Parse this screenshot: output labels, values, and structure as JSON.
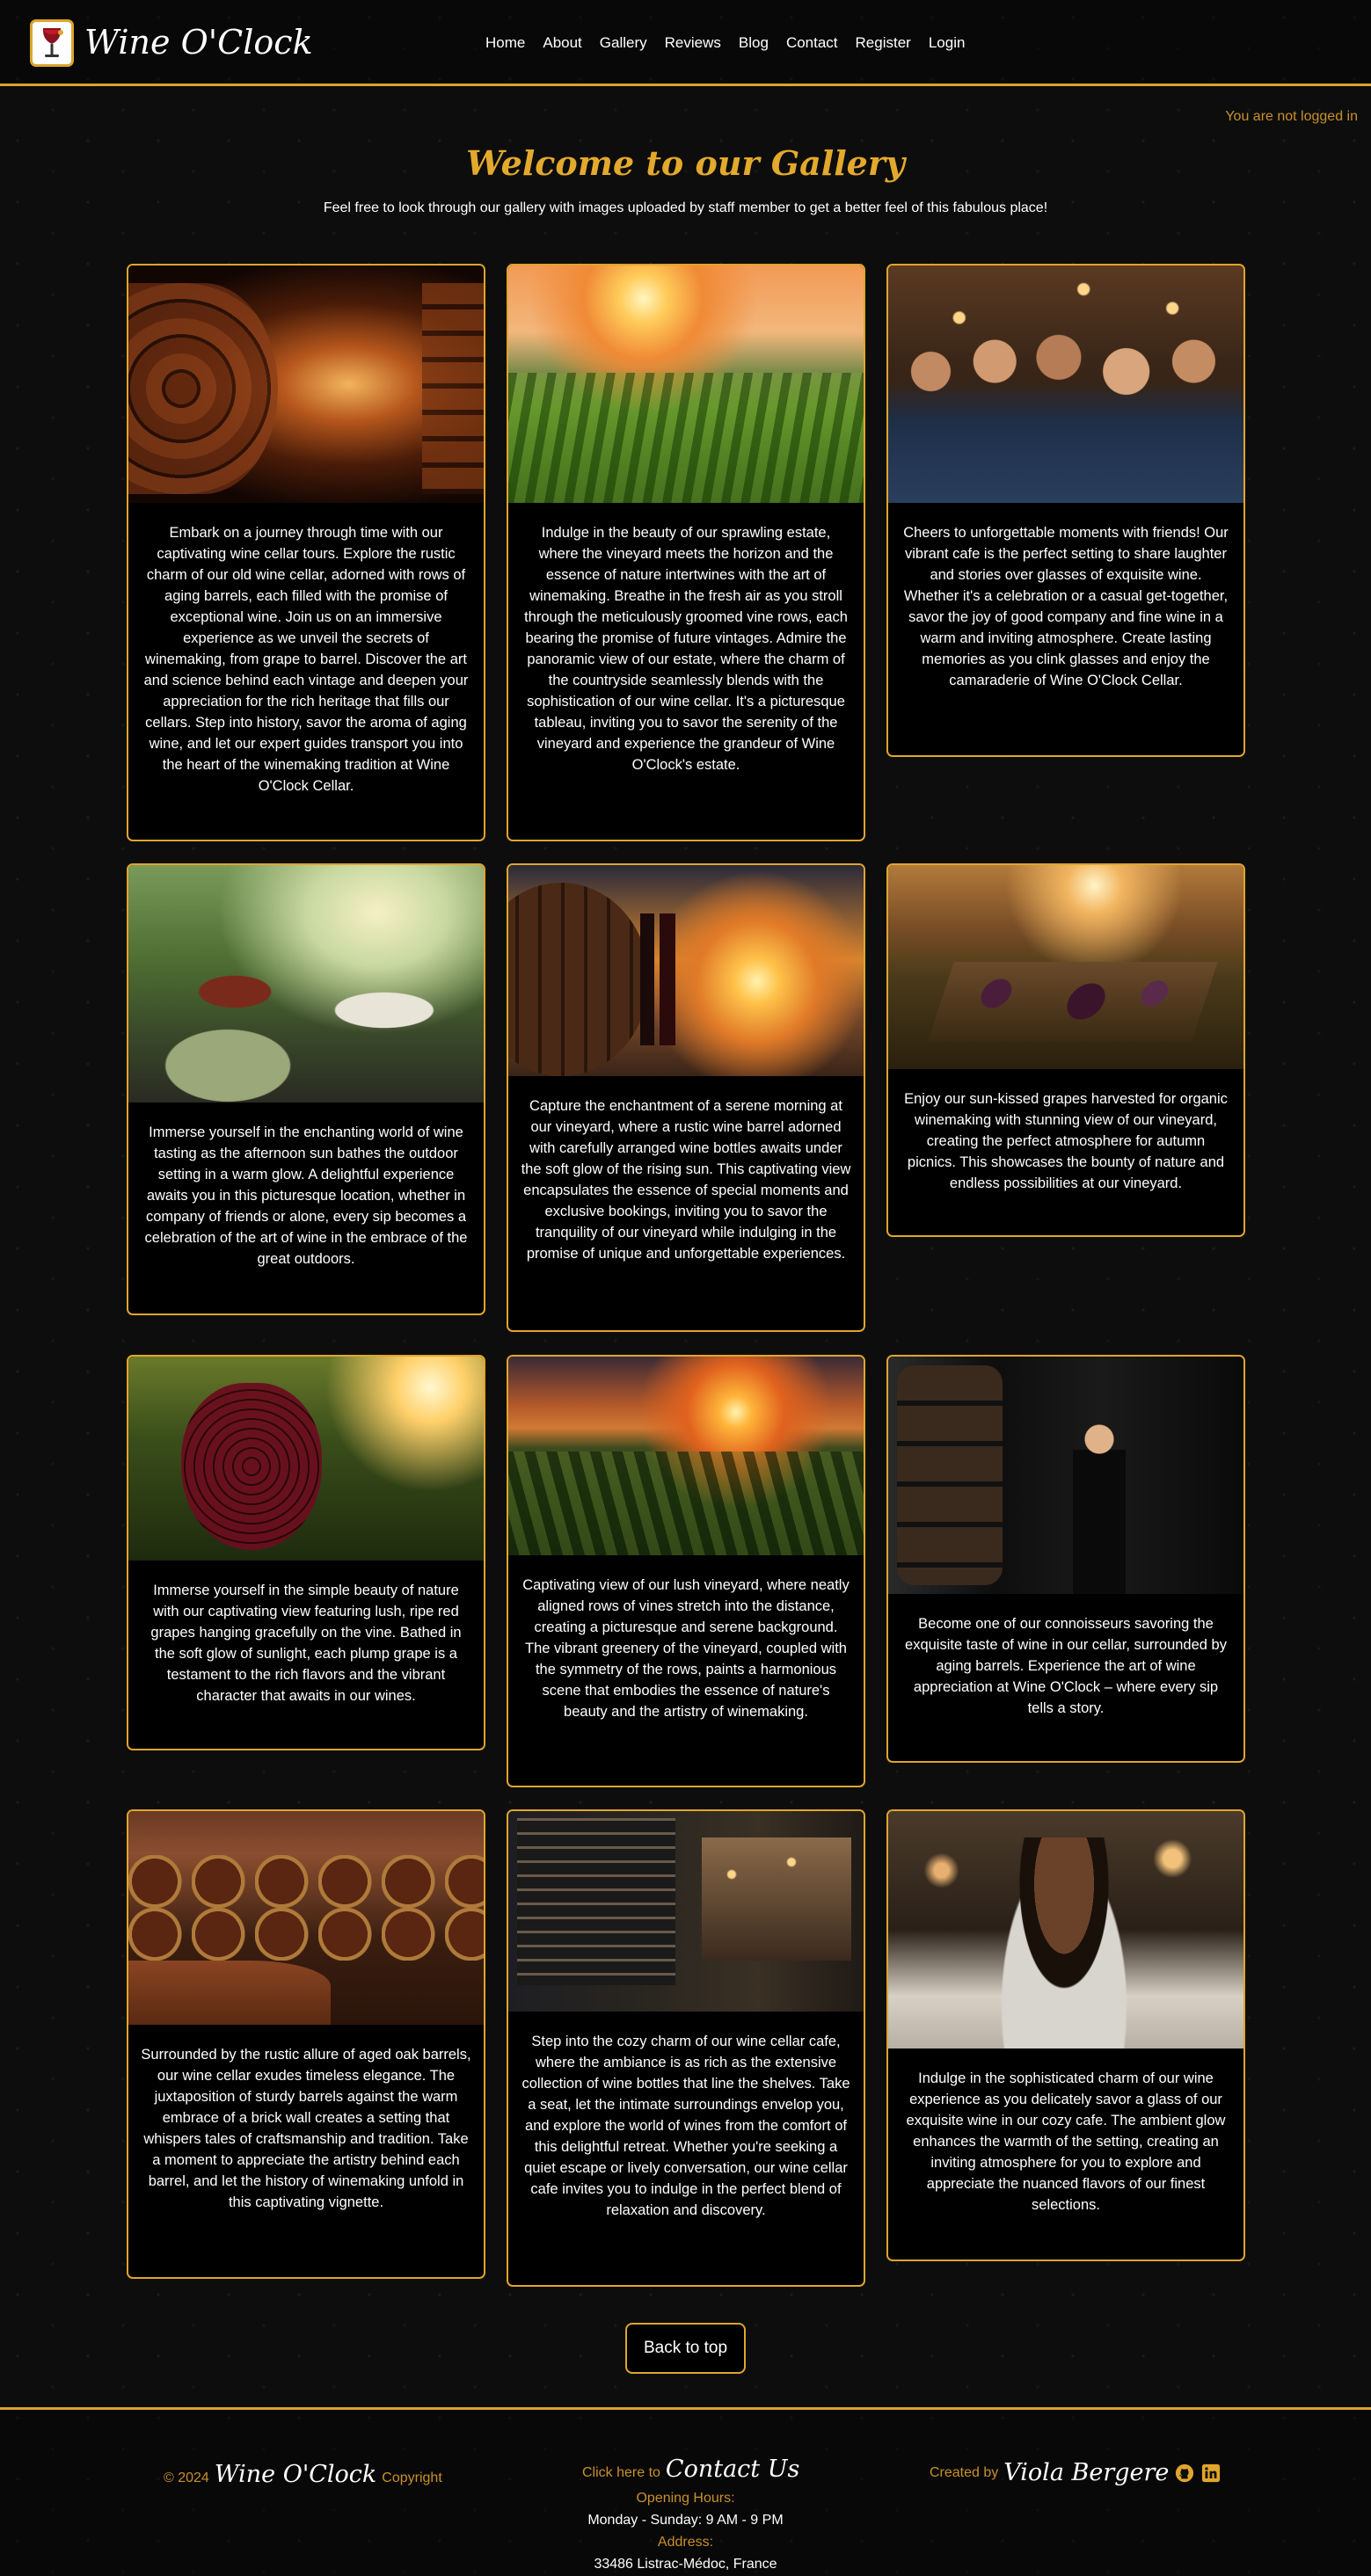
{
  "brand": {
    "name": "Wine O'Clock",
    "logo_icon": "wine-glass-logo-icon"
  },
  "nav": {
    "items": [
      "Home",
      "About",
      "Gallery",
      "Reviews",
      "Blog",
      "Contact",
      "Register",
      "Login"
    ]
  },
  "auth": {
    "status": "You are not logged in"
  },
  "page": {
    "title": "Welcome to our Gallery",
    "subtitle": "Feel free to look through our gallery with images uploaded by staff member to get a better feel of this fabulous place!"
  },
  "gallery": [
    {
      "image": "wine-cellar-tunnel",
      "caption": "Embark on a journey through time with our captivating wine cellar tours. Explore the rustic charm of our old wine cellar, adorned with rows of aging barrels, each filled with the promise of exceptional wine. Join us on an immersive experience as we unveil the secrets of winemaking, from grape to barrel. Discover the art and science behind each vintage and deepen your appreciation for the rich heritage that fills our cellars. Step into history, savor the aroma of aging wine, and let our expert guides transport you into the heart of the winemaking tradition at Wine O'Clock Cellar."
    },
    {
      "image": "vineyard-estate-sunset",
      "caption": "Indulge in the beauty of our sprawling estate, where the vineyard meets the horizon and the essence of nature intertwines with the art of winemaking. Breathe in the fresh air as you stroll through the meticulously groomed vine rows, each bearing the promise of future vintages. Admire the panoramic view of our estate, where the charm of the countryside seamlessly blends with the sophistication of our wine cellar. It's a picturesque tableau, inviting you to savor the serenity of the vineyard and experience the grandeur of Wine O'Clock's estate."
    },
    {
      "image": "friends-toasting-cafe",
      "caption": "Cheers to unforgettable moments with friends! Our vibrant cafe is the perfect setting to share laughter and stories over glasses of exquisite wine. Whether it's a celebration or a casual get-together, savor the joy of good company and fine wine in a warm and inviting atmosphere. Create lasting memories as you clink glasses and enjoy the camaraderie of Wine O'Clock Cellar."
    },
    {
      "image": "outdoor-wine-tasting",
      "caption": "Immerse yourself in the enchanting world of wine tasting as the afternoon sun bathes the outdoor setting in a warm glow. A delightful experience awaits you in this picturesque location, whether in company of friends or alone, every sip becomes a celebration of the art of wine in the embrace of the great outdoors."
    },
    {
      "image": "barrel-sunrise-vineyard",
      "caption": "Capture the enchantment of a serene morning at our vineyard, where a rustic wine barrel adorned with carefully arranged wine bottles awaits under the soft glow of the rising sun. This captivating view encapsulates the essence of special moments and exclusive bookings, inviting you to savor the tranquility of our vineyard while indulging in the promise of unique and unforgettable experiences."
    },
    {
      "image": "vineyard-picnic-table",
      "caption": "Enjoy our sun-kissed grapes harvested for organic winemaking with stunning view of our vineyard, creating the perfect atmosphere for autumn picnics. This showcases the bounty of nature and endless possibilities at our vineyard."
    },
    {
      "image": "ripe-red-grapes",
      "caption": "Immerse yourself in the simple beauty of nature with our captivating view featuring lush, ripe red grapes hanging gracefully on the vine. Bathed in the soft glow of sunlight, each plump grape is a testament to the rich flavors and the vibrant character that awaits in our wines."
    },
    {
      "image": "vineyard-rows-sunset",
      "caption": "Captivating view of our lush vineyard, where neatly aligned rows of vines stretch into the distance, creating a picturesque and serene background. The vibrant greenery of the vineyard, coupled with the symmetry of the rows, paints a harmonious scene that embodies the essence of nature's beauty and the artistry of winemaking."
    },
    {
      "image": "connoisseur-in-cellar",
      "caption": "Become one of our connoisseurs savoring the exquisite taste of wine in our cellar, surrounded by aging barrels. Experience the art of wine appreciation at Wine O'Clock – where every sip tells a story."
    },
    {
      "image": "barrel-brick-wall",
      "caption": "Surrounded by the rustic allure of aged oak barrels, our wine cellar exudes timeless elegance. The juxtaposition of sturdy barrels against the warm embrace of a brick wall creates a setting that whispers tales of craftsmanship and tradition. Take a moment to appreciate the artistry behind each barrel, and let the history of winemaking unfold in this captivating vignette."
    },
    {
      "image": "wine-cellar-cafe",
      "caption": "Step into the cozy charm of our wine cellar cafe, where the ambiance is as rich as the extensive collection of wine bottles that line the shelves. Take a seat, let the intimate surroundings envelop you, and explore the world of wines from the comfort of this delightful retreat. Whether you're seeking a quiet escape or lively conversation, our wine cellar cafe invites you to indulge in the perfect blend of relaxation and discovery."
    },
    {
      "image": "woman-savoring-wine",
      "caption": "Indulge in the sophisticated charm of our wine experience as you delicately savor a glass of our exquisite wine in our cozy cafe. The ambient glow enhances the warmth of the setting, creating an inviting atmosphere for you to explore and appreciate the nuanced flavors of our finest selections."
    }
  ],
  "back_to_top": "Back to top",
  "footer": {
    "year": "© 2024",
    "brand": "Wine O'Clock",
    "copyright": "Copyright",
    "contact_prefix": "Click here to",
    "contact_link": "Contact Us",
    "hours_label": "Opening Hours:",
    "hours_value": "Monday - Sunday: 9 AM - 9 PM",
    "address_label": "Address:",
    "address_value": "33486 Listrac-Médoc, France",
    "created_by": "Created by",
    "author": "Viola Bergere",
    "social": [
      "github-icon",
      "linkedin-icon"
    ]
  },
  "colors": {
    "accent": "#e0a52c",
    "accent_text": "#c8902a",
    "background": "#0d0d0d",
    "card_bg": "#000000"
  }
}
